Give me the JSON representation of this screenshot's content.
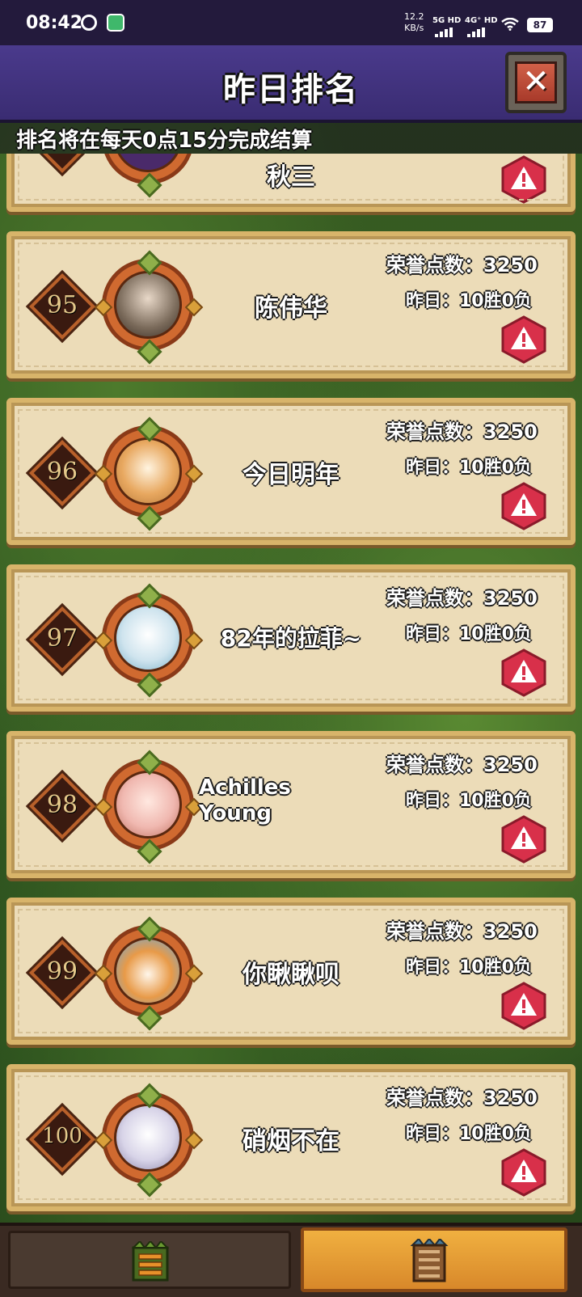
{
  "status_bar": {
    "time": "08:42",
    "speed_value": "12.2",
    "speed_unit": "KB/s",
    "network_1": "5G HD",
    "network_2": "4G⁺ HD",
    "battery": "87"
  },
  "header": {
    "title": "昨日排名",
    "close_icon": "close-icon"
  },
  "notice": "排名将在每天0点15分完成结算",
  "partial_row": {
    "name_fragment": "秋三"
  },
  "ranking_rows": [
    {
      "rank": "95",
      "name": "陈伟华",
      "honor": "荣誉点数：3250",
      "record": "昨日：10胜0负",
      "avatar_color": "#7a6a5a"
    },
    {
      "rank": "96",
      "name": "今日明年",
      "honor": "荣誉点数：3250",
      "record": "昨日：10胜0负",
      "avatar_color": "#e8a860"
    },
    {
      "rank": "97",
      "name": "82年的拉菲~",
      "honor": "荣誉点数：3250",
      "record": "昨日：10胜0负",
      "avatar_color": "#cfe4ee"
    },
    {
      "rank": "98",
      "name": "Achilles Young",
      "honor": "荣誉点数：3250",
      "record": "昨日：10胜0负",
      "avatar_color": "#f0b8b0"
    },
    {
      "rank": "99",
      "name": "你瞅瞅呗",
      "honor": "荣誉点数：3250",
      "record": "昨日：10胜0负",
      "avatar_color": "#e89a48"
    },
    {
      "rank": "100",
      "name": "硝烟不在",
      "honor": "荣誉点数：3250",
      "record": "昨日：10胜0负",
      "avatar_color": "#d8d4e8"
    }
  ],
  "report_icon": "warning-icon",
  "bottom_tabs": {
    "left_icon": "menu-list-icon",
    "right_icon": "ladder-icon"
  },
  "colors": {
    "title_bar": "#3a2c72",
    "card": "#ecdcb8",
    "report": "#d8304a"
  }
}
